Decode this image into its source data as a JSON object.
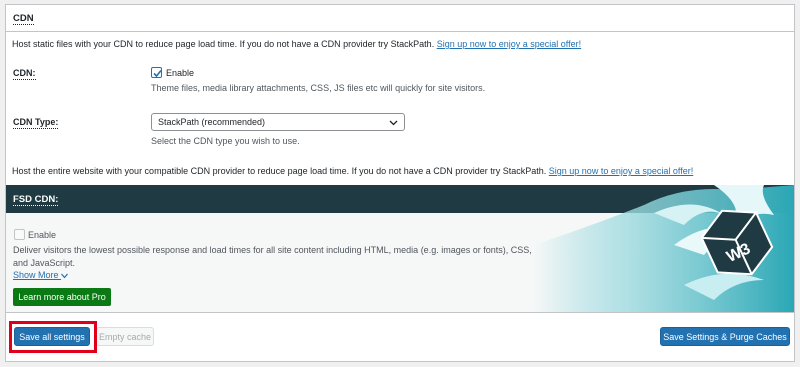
{
  "panel": {
    "title": "CDN"
  },
  "intro": {
    "text": "Host static files with your CDN to reduce page load time. If you do not have a CDN provider try StackPath.",
    "link": "Sign up now to enjoy a special offer!"
  },
  "cdn": {
    "label": "CDN:",
    "checkbox_label": "Enable",
    "checked": true,
    "description": "Theme files, media library attachments, CSS, JS files etc will quickly for site visitors."
  },
  "cdn_type": {
    "label": "CDN Type:",
    "selected": "StackPath (recommended)",
    "description": "Select the CDN type you wish to use."
  },
  "fsd_intro": {
    "text": "Host the entire website with your compatible CDN provider to reduce page load time. If you do not have a CDN provider try StackPath.",
    "link": "Sign up now to enjoy a special offer!"
  },
  "fsd": {
    "title": "FSD CDN:",
    "checkbox_label": "Enable",
    "checked": false,
    "description_line1": "Deliver visitors the lowest possible response and load times for all site content including HTML, media (e.g. images or fonts), CSS,",
    "description_line2": "and JavaScript.",
    "show_more": "Show More",
    "pro_button": "Learn more about Pro",
    "logo_text": "W3"
  },
  "footer": {
    "save_all": "Save all settings",
    "empty_cache": "Empty cache",
    "save_purge": "Save Settings & Purge Caches"
  },
  "colors": {
    "primary": "#2271b1",
    "pro_green": "#0b7a14",
    "highlight_red": "#e0001b",
    "fsd_header": "#1f3a42"
  }
}
